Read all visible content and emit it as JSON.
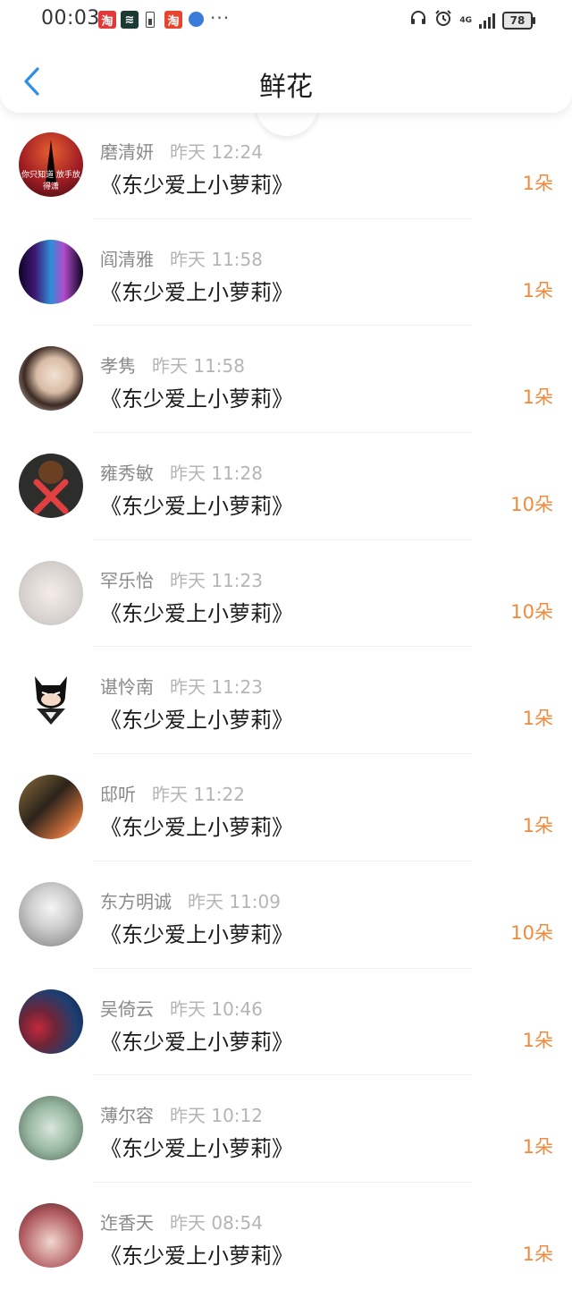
{
  "status_bar": {
    "time": "00:03",
    "notifications": [
      {
        "icon": "taobao-red-icon",
        "glyph": "淘"
      },
      {
        "icon": "app-dark-green-icon",
        "glyph": "≋"
      },
      {
        "icon": "battery-alert-icon",
        "glyph": ""
      },
      {
        "icon": "taobao-icon",
        "glyph": "淘"
      },
      {
        "icon": "browser-globe-icon",
        "glyph": ""
      }
    ],
    "more": "···",
    "network": "4G",
    "battery": "78"
  },
  "header": {
    "title": "鲜花",
    "back_icon": "chevron-left-icon"
  },
  "colors": {
    "accent": "#2f8fe8",
    "count": "#f08a3c",
    "name": "#8a8a8a",
    "time": "#b5b5b5"
  },
  "list": [
    {
      "name": "磨清妍",
      "time": "昨天 12:24",
      "book": "《东少爱上小萝莉》",
      "count": "1朵",
      "avatar_caption": "你只知道 放手放得潇"
    },
    {
      "name": "阎清雅",
      "time": "昨天 11:58",
      "book": "《东少爱上小萝莉》",
      "count": "1朵"
    },
    {
      "name": "孝隽",
      "time": "昨天 11:58",
      "book": "《东少爱上小萝莉》",
      "count": "1朵"
    },
    {
      "name": "雍秀敏",
      "time": "昨天 11:28",
      "book": "《东少爱上小萝莉》",
      "count": "10朵"
    },
    {
      "name": "罕乐怡",
      "time": "昨天 11:23",
      "book": "《东少爱上小萝莉》",
      "count": "10朵"
    },
    {
      "name": "谌怜南",
      "time": "昨天 11:23",
      "book": "《东少爱上小萝莉》",
      "count": "1朵"
    },
    {
      "name": "邸听",
      "time": "昨天 11:22",
      "book": "《东少爱上小萝莉》",
      "count": "1朵"
    },
    {
      "name": "东方明诚",
      "time": "昨天 11:09",
      "book": "《东少爱上小萝莉》",
      "count": "10朵"
    },
    {
      "name": "吴倚云",
      "time": "昨天 10:46",
      "book": "《东少爱上小萝莉》",
      "count": "1朵"
    },
    {
      "name": "薄尔容",
      "time": "昨天 10:12",
      "book": "《东少爱上小萝莉》",
      "count": "1朵"
    },
    {
      "name": "迮香天",
      "time": "昨天 08:54",
      "book": "《东少爱上小萝莉》",
      "count": "1朵"
    }
  ]
}
